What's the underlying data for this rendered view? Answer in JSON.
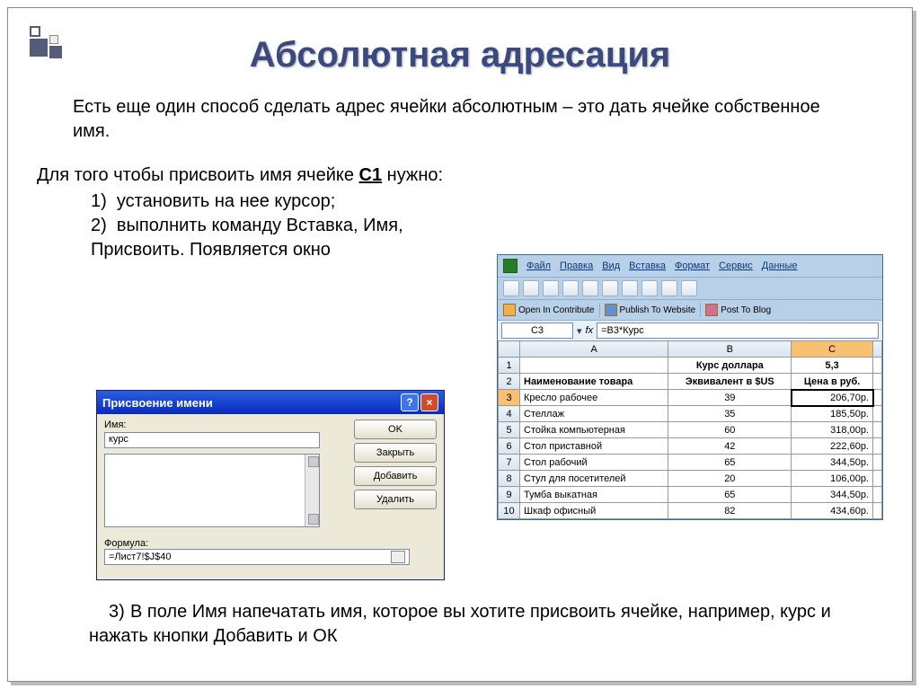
{
  "title": "Абсолютная адресация",
  "intro": "Есть еще один способ сделать адрес ячейки абсолютным – это дать ячейке собственное имя.",
  "steps_lead": "Для того чтобы присвоить имя ячейке ",
  "steps_lead_cell": "С1",
  "steps_lead_tail": " нужно:",
  "step1": "установить на нее курсор;",
  "step2": "выполнить команду Вставка, Имя, Присвоить. Появляется окно",
  "step3": "В поле Имя напечатать имя, которое вы хотите присвоить ячейке, например, курс и нажать кнопки Добавить и ОК",
  "dialog": {
    "title": "Присвоение имени",
    "label_name": "Имя:",
    "name_value": "курс",
    "label_formula": "Формула:",
    "formula_value": "=Лист7!$J$40",
    "btn_ok": "OK",
    "btn_close": "Закрыть",
    "btn_add": "Добавить",
    "btn_delete": "Удалить",
    "help_icon": "?",
    "close_icon": "×"
  },
  "excel": {
    "menu": [
      "Файл",
      "Правка",
      "Вид",
      "Вставка",
      "Формат",
      "Сервис",
      "Данные"
    ],
    "contribute": [
      "Open In Contribute",
      "Publish To Website",
      "Post To Blog"
    ],
    "namebox": "C3",
    "fx_label": "fx",
    "formula": "=B3*Курс",
    "col_headers": [
      "A",
      "B",
      "C"
    ],
    "rows": [
      {
        "n": "1",
        "a": "",
        "b": "Курс доллара",
        "c": "5,3",
        "b_bold": true,
        "c_bold": true,
        "b_center": true,
        "c_center": true
      },
      {
        "n": "2",
        "a": "Наименование товара",
        "b": "Эквивалент в $US",
        "c": "Цена в руб.",
        "a_bold": true,
        "b_bold": true,
        "c_bold": true,
        "b_center": true,
        "c_center": true
      },
      {
        "n": "3",
        "a": "Кресло рабочее",
        "b": "39",
        "c": "206,70р.",
        "b_center": true,
        "c_right": true,
        "sel": true
      },
      {
        "n": "4",
        "a": "Стеллаж",
        "b": "35",
        "c": "185,50р.",
        "b_center": true,
        "c_right": true
      },
      {
        "n": "5",
        "a": "Стойка компьютерная",
        "b": "60",
        "c": "318,00р.",
        "b_center": true,
        "c_right": true
      },
      {
        "n": "6",
        "a": "Стол приставной",
        "b": "42",
        "c": "222,60р.",
        "b_center": true,
        "c_right": true
      },
      {
        "n": "7",
        "a": "Стол рабочий",
        "b": "65",
        "c": "344,50р.",
        "b_center": true,
        "c_right": true
      },
      {
        "n": "8",
        "a": "Стул для посетителей",
        "b": "20",
        "c": "106,00р.",
        "b_center": true,
        "c_right": true
      },
      {
        "n": "9",
        "a": "Тумба выкатная",
        "b": "65",
        "c": "344,50р.",
        "b_center": true,
        "c_right": true
      },
      {
        "n": "10",
        "a": "Шкаф офисный",
        "b": "82",
        "c": "434,60р.",
        "b_center": true,
        "c_right": true
      }
    ]
  }
}
